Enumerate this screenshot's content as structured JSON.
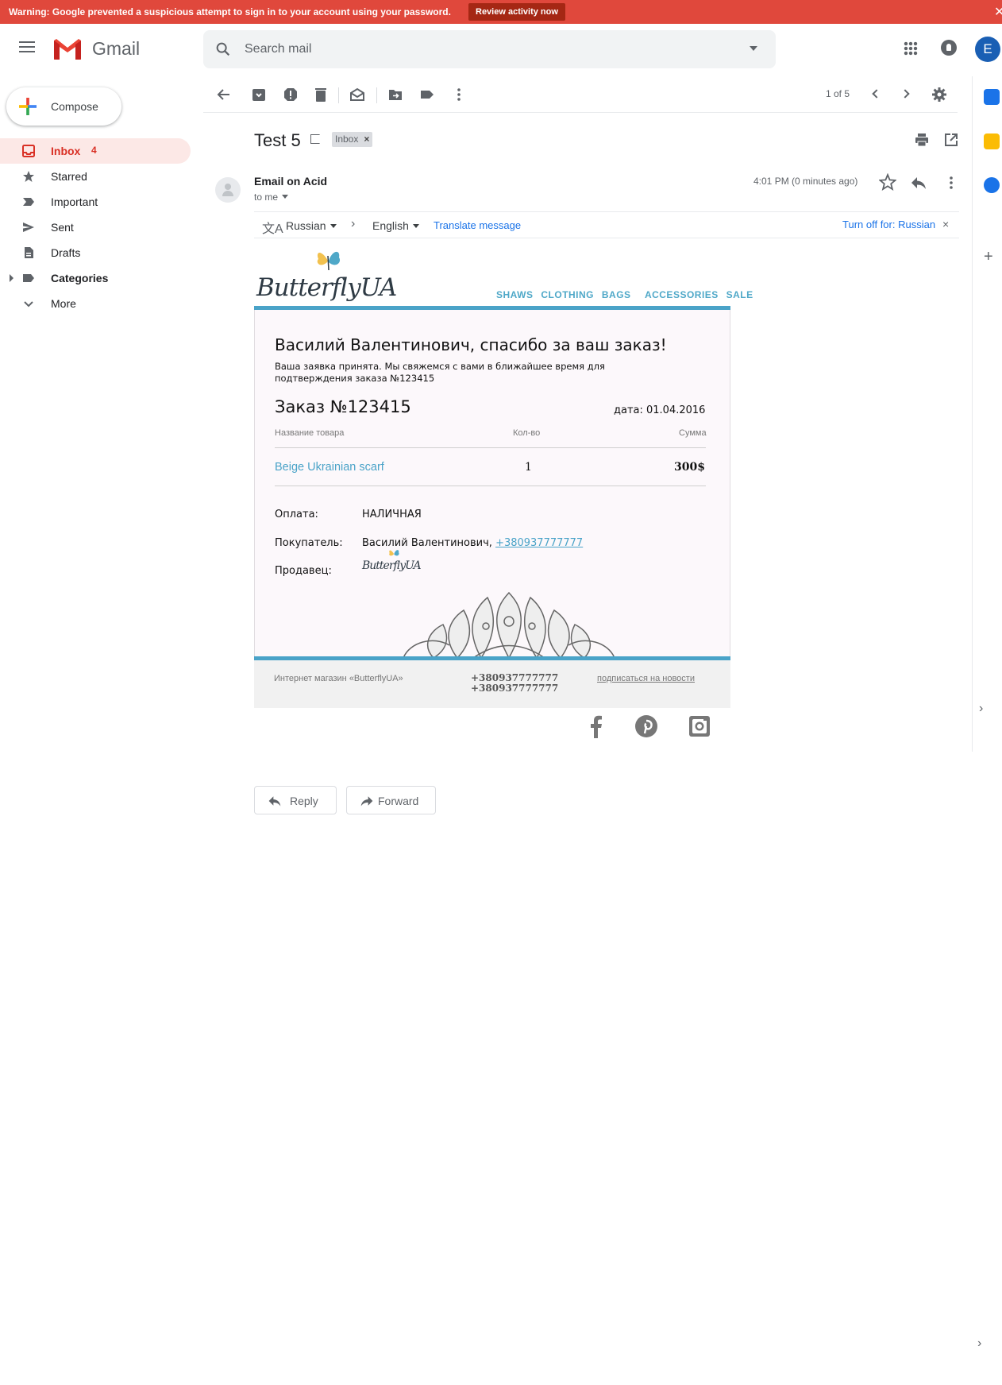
{
  "warning": {
    "message": "Warning: Google prevented a suspicious attempt to sign in to your account using your password.",
    "review_label": "Review activity now",
    "close": "✕"
  },
  "topbar": {
    "app_name": "Gmail",
    "search_placeholder": "Search mail",
    "avatar_initial": "E"
  },
  "compose_label": "Compose",
  "nav": [
    {
      "label": "Inbox",
      "count": "4"
    },
    {
      "label": "Starred"
    },
    {
      "label": "Important"
    },
    {
      "label": "Sent"
    },
    {
      "label": "Drafts"
    },
    {
      "label": "Categories"
    },
    {
      "label": "More"
    }
  ],
  "toolbar": {
    "pager": "1 of 5"
  },
  "message": {
    "subject": "Test 5",
    "label_chip": "Inbox",
    "sender": "Email on Acid",
    "to": "to me",
    "time": "4:01 PM (0 minutes ago)"
  },
  "translate": {
    "from_lang": "Russian",
    "to_lang": "English",
    "translate_link": "Translate message",
    "turn_off": "Turn off for: Russian"
  },
  "email": {
    "brand": "ButterflyUA",
    "nav": [
      "SHAWS",
      "CLOTHING",
      "BAGS",
      "ACCESSORIES",
      "SALE"
    ],
    "heading": "Василий Валентинович, спасибо за ваш заказ!",
    "intro": "Ваша заявка принята. Мы свяжемся с вами в ближайшее время для подтверждения заказа №123415",
    "order_title": "Заказ №123415",
    "date": "дата: 01.04.2016",
    "col_name": "Название товара",
    "col_qty": "Кол-во",
    "col_sum": "Сумма",
    "item_name": "Beige Ukrainian scarf",
    "item_qty": "1",
    "item_sum": "300$",
    "payment_label": "Оплата:",
    "payment_value": "НАЛИЧНАЯ",
    "buyer_label": "Покупатель:",
    "buyer_name": "Василий Валентинович,",
    "buyer_phone": "+380937777777",
    "seller_label": "Продавец:",
    "seller_logo": "ButterflyUA",
    "footer_shop": "Интернет магазин «ButterflyUA»",
    "footer_phone1": "+380937777777",
    "footer_phone2": "+380937777777",
    "footer_subscribe": "подписаться на новости"
  },
  "actions": {
    "reply": "Reply",
    "forward": "Forward"
  },
  "colors": {
    "accent_red": "#d93025",
    "email_blue": "#4aa3c8",
    "warning_bg": "#e0483c"
  }
}
